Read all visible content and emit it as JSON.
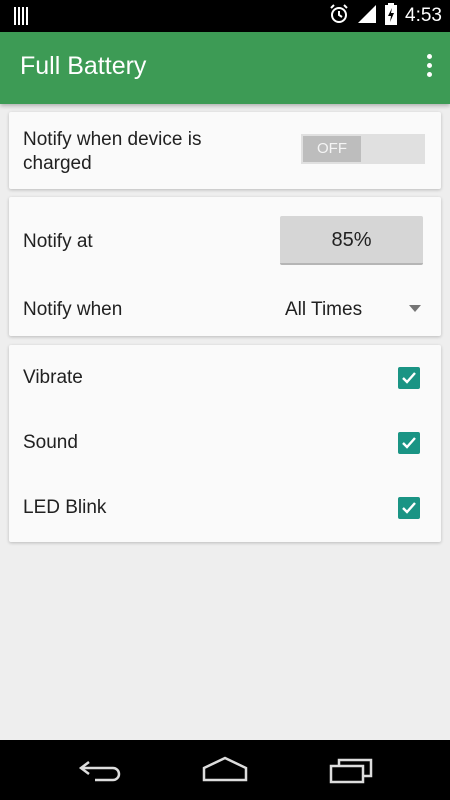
{
  "status_bar": {
    "time": "4:53",
    "icons": [
      "notification-icon",
      "alarm-icon",
      "signal-icon",
      "battery-charging-icon"
    ]
  },
  "app_bar": {
    "title": "Full Battery",
    "menu_icon": "overflow-menu-icon"
  },
  "charged_card": {
    "label": "Notify when device is charged",
    "toggle_text": "OFF",
    "toggle_on": false
  },
  "notify_card": {
    "notify_at_label": "Notify at",
    "notify_at_value": "85%",
    "notify_when_label": "Notify when",
    "notify_when_value": "All Times"
  },
  "options_card": {
    "items": [
      {
        "label": "Vibrate",
        "checked": true
      },
      {
        "label": "Sound",
        "checked": true
      },
      {
        "label": "LED Blink",
        "checked": true
      }
    ]
  },
  "nav_bar": {
    "icons": [
      "back-icon",
      "home-icon",
      "recents-icon"
    ]
  },
  "colors": {
    "app_bar": "#3d9b55",
    "checkbox": "#1a9484",
    "background": "#eeeeee"
  }
}
